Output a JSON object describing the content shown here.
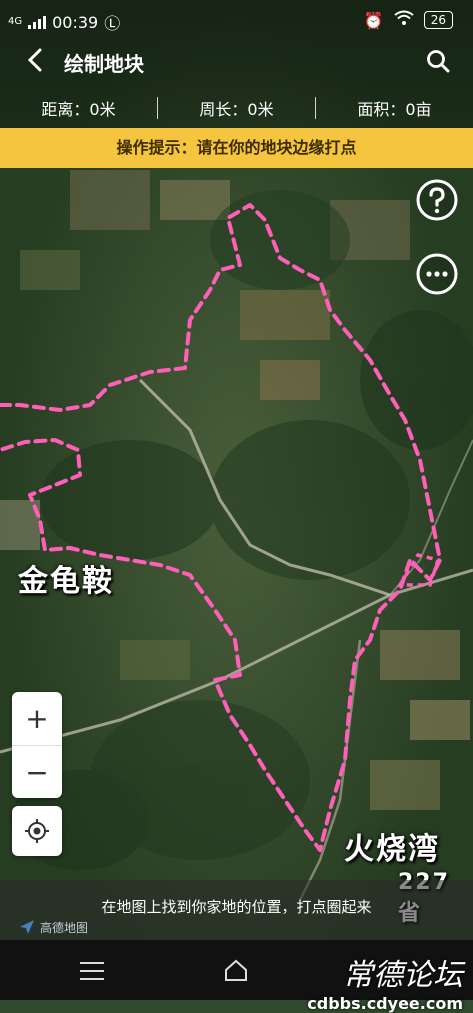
{
  "status": {
    "network": "4G",
    "time": "00:39",
    "battery": "26"
  },
  "header": {
    "title": "绘制地块"
  },
  "stats": {
    "distance": "距离：0米",
    "perimeter": "周长：0米",
    "area": "面积：0亩"
  },
  "hint": "操作提示：请在你的地块边缘打点",
  "places": {
    "west": "金龟鞍",
    "east": "火烧湾",
    "route": "227省"
  },
  "bottom": {
    "instruction": "在地图上找到你家地的位置，打点圈起来",
    "logo": "高德地图"
  },
  "watermark": {
    "big": "常德论坛",
    "small": "cdbbs.cdyee.com"
  },
  "zoom": {
    "plus": "+",
    "minus": "−"
  },
  "colors": {
    "boundary": "#ff5fb8",
    "hint_bar": "#f5c540"
  }
}
